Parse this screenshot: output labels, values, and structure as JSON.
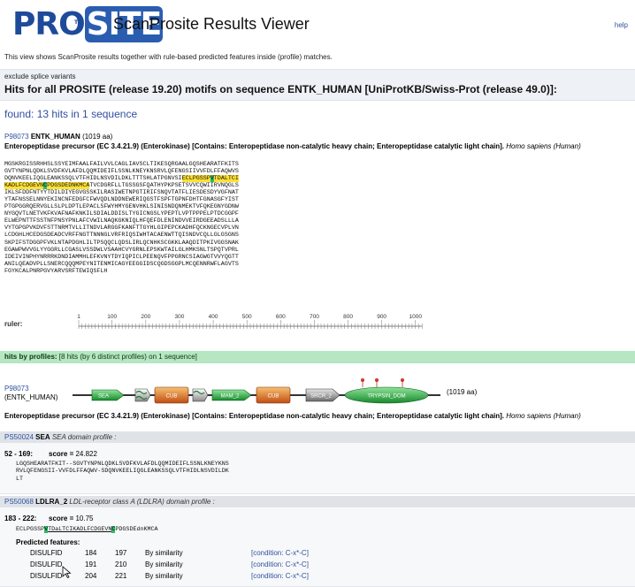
{
  "header": {
    "logo_pre": "PRO",
    "logo_post": "SITE",
    "logo_tm": "TM",
    "app_title": "ScanProsite Results Viewer",
    "help_link": "help"
  },
  "intro_text": "This view shows ScanProsite results together with rule-based predicted features inside (profile) matches.",
  "exclude_link": "exclude splice variants",
  "hits_title": "Hits for all PROSITE (release 19.20) motifs on sequence ENTK_HUMAN [UniProtKB/Swiss-Prot (release 49.0)]:",
  "found_summary": "found: 13 hits in 1 sequence",
  "entry": {
    "accession": "P98073",
    "id": "ENTK_HUMAN",
    "length": "(1019 aa)",
    "description": "Enteropeptidase precursor (EC 3.4.21.9) (Enterokinase) [Contains: Enteropeptidase non-catalytic heavy chain; Enteropeptidase catalytic light chain].",
    "organism": "Homo sapiens (Human)"
  },
  "sequence": {
    "line1": "MGSKRGISSRHHSLSSYEIMFAALFAILVVLCAGLIAVSCLTIKESQRGAALGQSHEARATFKITS",
    "line2": "GVTYNPNLQDKLSVDFKVLAFDLQQMIDEIFLSSNLKNEYKNSRVLQFENGSIIVVFDLFFAQWVS",
    "line3a": "DQNVKEELIQGLEANKSSQLVTFHIDLNSVDILDKLTTTSHLATPGNVSI",
    "line3b": "ECLPGSSP",
    "line3c": "V",
    "line3d": "TDALTCI",
    "line4a": "KADLFCDGEVN",
    "line4b": "C",
    "line4c": "PDGSDEDNKMCA",
    "line4d": "TVCDGRFLLTGSSGSFQATHYPKPSETSVVCQWIIRVNQGLS",
    "rest": "IKLSFDDFNTYYTDILDIYEGVGSSKILRASIWETNPGTIRIFSNQVTATFLIESDESDYVGFNAT\nYTAFNSSELNNYEKINCNFEDGFCFWVQDLNDDNEWERIQGSTFSPFTGPNFDHTFGNASGFYIST\nPTGPGGRQERVGLLSLPLDPTLEPACLSFWYHMYGENVHKLSINISNDQNMEKTVFQKEGNYGDNW\nNYGQVTLNETVKFKVAFNAFKNKILSDIALDDISLTYGICNGSLYPEPTLVPTPPPELPTDCGGPF\nELWEPNTTFSSTNFPNSYPNLAFCVWILNAQKGKNIQLHFQEFDLENINDVVEIRDGEEADSLLLA\nVYTGPGPVKDVFSTTNRMTVLLITNDVLARGGFKANFTTGYHLGIPEPCKADHFQCKNGECVPLVN\nLCDGHLHCEDGSDEADCVRFFNGTTNNNGLVRFRIQSIWHTACAENWTTQISNDVCQLLGLGSGNS\nSKPIFSTDGGPFVKLNTAPDGHLILTPSQQCLQDSLIRLQCNHKSCGKKLAAQDITPKIVGGSNAK\nEGAWPWVVGLYYGGRLLCGASLVSSDWLVSAAHCVYGRNLEPSKWTAILGLHMKSNLTSPQTVPRL\nIDEIVINPHYNRRRKDNDIAMMHLEFKVNYTDYIQPICLPEENQVFPPGRNCSIAGWGTVVYQGTT\nANILQEADVPLLSNERCQQQMPEYNITENMICAGYEEGGIDSCQGDSGGPLMCQENNRWFLAGVTS\nFGYKCALPNRPGVYARVSRFTEWIQSFLH"
  },
  "ruler": {
    "label": "ruler:",
    "ticks": [
      "1",
      "100",
      "200",
      "300",
      "400",
      "500",
      "600",
      "700",
      "800",
      "900",
      "1000"
    ]
  },
  "profiles_bar": {
    "label": "hits by profiles:",
    "detail": "[8 hits (by 6 distinct profiles) on 1 sequence]"
  },
  "diagram": {
    "accession": "P98073",
    "id": "(ENTK_HUMAN)",
    "length": "(1019 aa)",
    "domains": [
      "SEA",
      "CUB",
      "MAM_2",
      "CUB",
      "SRCR_2",
      "TRYPSIN_DOM"
    ],
    "description": "Enteropeptidase precursor (EC 3.4.21.9) (Enterokinase) [Contains: Enteropeptidase non-catalytic heavy chain; Enteropeptidase catalytic light chain].",
    "organism": "Homo sapiens (Human)"
  },
  "hit1": {
    "accession": "PS50024",
    "name": "SEA",
    "desc": "SEA domain profile :",
    "range": "52 - 169:",
    "score_label": "score =",
    "score": "24.822",
    "align1": "LGQSHEARATFKIT--SGVTYNPNLQDKLSVDFKVLAFDLQQMIDEIFLSSNLKNEYKNS",
    "align2": "RVLQFENGSII-VVFDLFFAQWV-SDQNVKEELIQGLEANKSSQLVTFHIDLNSVDILDK",
    "align3": "LT"
  },
  "hit2": {
    "accession": "PS50068",
    "name": "LDLRA_2",
    "desc": "LDL-receptor class A (LDLRA) domain profile :",
    "range": "183 - 222:",
    "score_label": "score =",
    "score": "10.75",
    "seq_a": "ECLPGSSP",
    "seq_b": "V",
    "seq_c": "TDaLTCIKADLFCDGEVN",
    "seq_d": "C",
    "seq_e": "PDGSDEdnKMCA",
    "features_title": "Predicted features:",
    "features": [
      {
        "type": "DISULFID",
        "from": "184",
        "to": "197",
        "evidence": "By similarity",
        "condition": "[condition: C-x*-C]"
      },
      {
        "type": "DISULFID",
        "from": "191",
        "to": "210",
        "evidence": "By similarity",
        "condition": "[condition: C-x*-C]"
      },
      {
        "type": "DISULFID",
        "from": "204",
        "to": "221",
        "evidence": "By similarity",
        "condition": "[condition: C-x*-C]"
      }
    ]
  }
}
